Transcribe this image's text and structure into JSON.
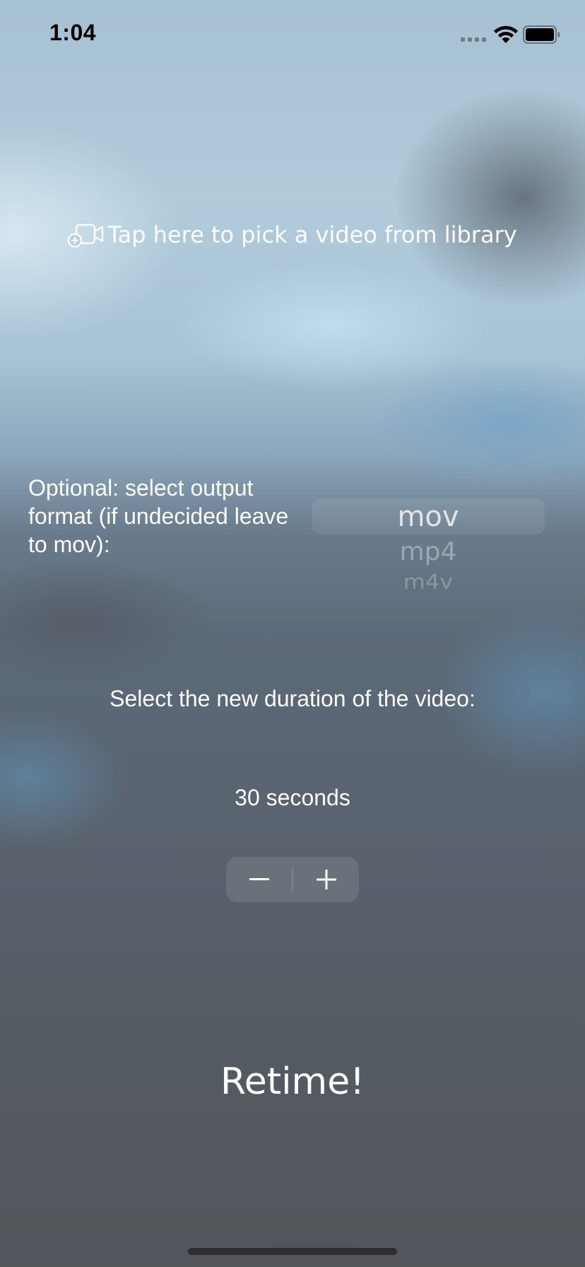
{
  "status_bar": {
    "time": "1:04"
  },
  "video_picker": {
    "icon": "video-plus-icon",
    "label": "Tap here to pick a video from library"
  },
  "format": {
    "label": "Optional: select output format (if undecided leave to mov):",
    "options": [
      "mov",
      "mp4",
      "m4v"
    ],
    "selected": "mov"
  },
  "duration": {
    "title": "Select the new duration of the video:",
    "value_label": "30 seconds",
    "value": 30,
    "stepper": {
      "decrement_icon": "minus-icon",
      "increment_icon": "plus-icon"
    }
  },
  "retime_button": {
    "label": "Retime!"
  }
}
